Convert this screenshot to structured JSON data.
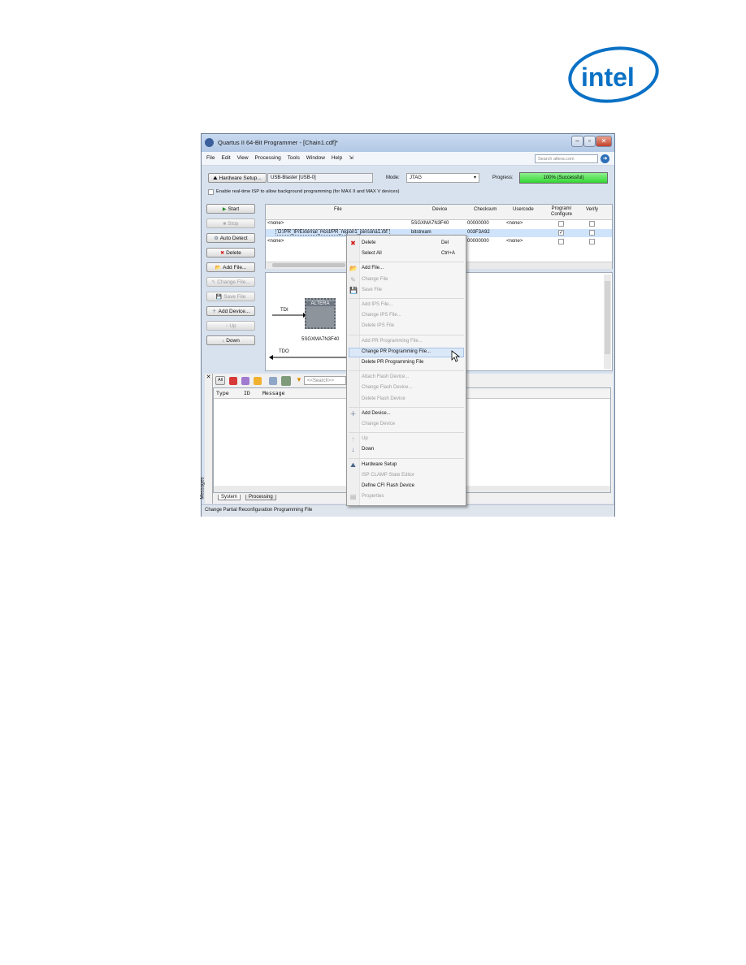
{
  "logo": {
    "text": "intel"
  },
  "window": {
    "title": "Quartus II 64-Bit Programmer - [Chain1.cdf]*",
    "menu": [
      "File",
      "Edit",
      "View",
      "Processing",
      "Tools",
      "Window",
      "Help"
    ],
    "search_placeholder": "Search altera.com"
  },
  "toolbar": {
    "hardware_setup": "Hardware Setup...",
    "hardware_value": "USB-Blaster [USB-0]",
    "mode_label": "Mode:",
    "mode_value": "JTAG",
    "progress_label": "Progress:",
    "progress_text": "100% (Successful)",
    "progress_value": 100,
    "isp_checkbox": "Enable real-time ISP to allow background programming (for MAX II and MAX V devices)"
  },
  "side_buttons": [
    {
      "label": "Start",
      "enabled": true,
      "icon": "start-icon"
    },
    {
      "label": "Stop",
      "enabled": false,
      "icon": "stop-icon"
    },
    {
      "label": "Auto Detect",
      "enabled": true,
      "icon": "auto-detect-icon"
    },
    {
      "label": "Delete",
      "enabled": true,
      "icon": "delete-icon"
    },
    {
      "label": "Add File...",
      "enabled": true,
      "icon": "add-file-icon"
    },
    {
      "label": "Change File...",
      "enabled": false,
      "icon": "change-file-icon"
    },
    {
      "label": "Save File",
      "enabled": false,
      "icon": "save-file-icon"
    },
    {
      "label": "Add Device...",
      "enabled": true,
      "icon": "add-device-icon"
    },
    {
      "label": "Up",
      "enabled": false,
      "icon": "up-icon"
    },
    {
      "label": "Down",
      "enabled": true,
      "icon": "down-icon"
    }
  ],
  "table": {
    "columns": [
      "File",
      "Device",
      "Checksum",
      "Usercode",
      "Program/ Configure",
      "Verify"
    ],
    "rows": [
      {
        "file": "<none>",
        "device": "5SGXMA7N3F40",
        "checksum": "00000000",
        "usercode": "<none>",
        "program": false,
        "verify": false
      },
      {
        "file": "D:/PR_IP/External_Host/PR_region1_persona1.rbf",
        "device": "bitstream",
        "checksum": "003F3A92",
        "usercode": "",
        "program": true,
        "verify": false
      },
      {
        "file": "<none>",
        "device": "",
        "checksum": "00000000",
        "usercode": "<none>",
        "program": false,
        "verify": false
      }
    ]
  },
  "chain": {
    "tdi": "TDI",
    "tdo": "TDO",
    "chip_logo": "ALTERA",
    "device": "5SGXMA7N3F40"
  },
  "messages": {
    "filter_all": "All",
    "search_placeholder": "<<Search>>",
    "columns": [
      "Type",
      "ID",
      "Message"
    ],
    "side_label": "Messages",
    "tabs": [
      "System",
      "Processing"
    ]
  },
  "status_bar": "Change Partial Reconfiguration Programming File",
  "context_menu": [
    {
      "label": "Delete",
      "shortcut": "Del",
      "enabled": true,
      "icon": "red-x-icon"
    },
    {
      "label": "Select All",
      "shortcut": "Ctrl+A",
      "enabled": true
    },
    {
      "sep": true
    },
    {
      "label": "Add File...",
      "enabled": true,
      "icon": "add-file-icon"
    },
    {
      "label": "Change File",
      "enabled": false,
      "icon": "change-file-icon"
    },
    {
      "label": "Save File",
      "enabled": false,
      "icon": "save-file-icon"
    },
    {
      "sep": true
    },
    {
      "label": "Add IPS File...",
      "enabled": false
    },
    {
      "label": "Change IPS File...",
      "enabled": false
    },
    {
      "label": "Delete IPS File",
      "enabled": false
    },
    {
      "sep": true
    },
    {
      "label": "Add PR Programming File...",
      "enabled": false
    },
    {
      "label": "Change PR Programming File...",
      "enabled": true,
      "highlight": true
    },
    {
      "label": "Delete PR Programming File",
      "enabled": true
    },
    {
      "sep": true
    },
    {
      "label": "Attach Flash Device...",
      "enabled": false
    },
    {
      "label": "Change Flash Device...",
      "enabled": false
    },
    {
      "label": "Delete Flash Device",
      "enabled": false
    },
    {
      "sep": true
    },
    {
      "label": "Add Device...",
      "enabled": true,
      "icon": "add-device-icon"
    },
    {
      "label": "Change Device",
      "enabled": false
    },
    {
      "sep": true
    },
    {
      "label": "Up",
      "enabled": false,
      "icon": "up-icon"
    },
    {
      "label": "Down",
      "enabled": true,
      "icon": "down-icon"
    },
    {
      "sep": true
    },
    {
      "label": "Hardware Setup",
      "enabled": true,
      "icon": "hardware-setup-icon"
    },
    {
      "label": "ISP CLAMP State Editor",
      "enabled": false
    },
    {
      "label": "Define CFI Flash Device",
      "enabled": true
    },
    {
      "label": "Properties",
      "enabled": false,
      "icon": "properties-icon"
    }
  ]
}
